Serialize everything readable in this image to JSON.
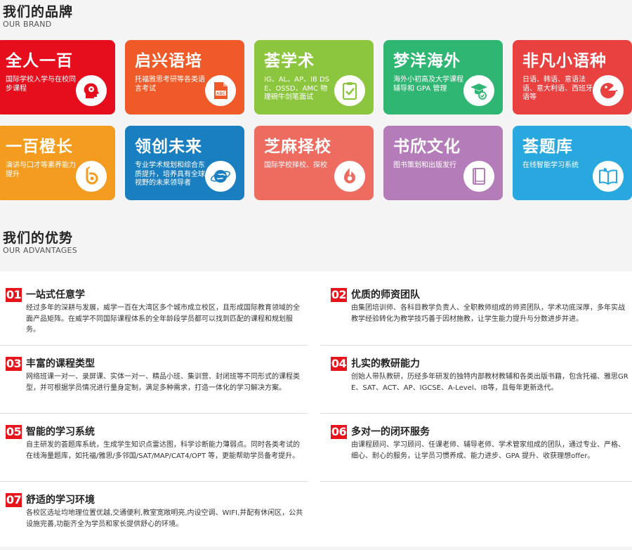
{
  "brand_section": {
    "title": "我们的品牌",
    "subtitle": "OUR BRAND"
  },
  "brands": [
    {
      "name": "全人一百",
      "desc": "国际学校入学与在校同步课程",
      "color": "#e60d1d",
      "icon": "head-gear-icon"
    },
    {
      "name": "启兴语培",
      "desc": "托福雅思考研等各类语言考试",
      "color": "#f05a28",
      "icon": "abc-document-icon"
    },
    {
      "name": "荟学术",
      "desc": "IG、AL、AP、IB DSE、OSSD、AMC 物理碗牛剑笔面试",
      "color": "#8cc63f",
      "icon": "clipboard-check-icon"
    },
    {
      "name": "梦洋海外",
      "desc": "海外小初高及大学课程辅导和 GPA 管理",
      "color": "#2fb673",
      "icon": "graduate-icon"
    },
    {
      "name": "非凡小语种",
      "desc": "日语、韩语、意语法语、意大利语、西班牙语等",
      "color": "#e94040",
      "icon": "speech-face-icon"
    },
    {
      "name": "一百橙长",
      "desc": "演讲与口才等素养能力提升",
      "color": "#f39c1f",
      "icon": "growth-logo-icon"
    },
    {
      "name": "领创未来",
      "desc": "专业学术规划和综合东质提升，培养具有全球视野的未来领导者",
      "color": "#1a7fc1",
      "icon": "globe-icon"
    },
    {
      "name": "芝麻择校",
      "desc": "国际学校择校、探校",
      "color": "#ee6b60",
      "icon": "location-pin-icon"
    },
    {
      "name": "书欣文化",
      "desc": "图书策划和出版发行",
      "color": "#b47cb8",
      "icon": "book-icon"
    },
    {
      "name": "荟题库",
      "desc": "在线智能学习系统",
      "color": "#29a8e0",
      "icon": "open-book-icon"
    }
  ],
  "advantage_section": {
    "title": "我们的优势",
    "subtitle": "OUR ADVANTAGES"
  },
  "advantages": [
    {
      "num": "01",
      "title": "一站式任意学",
      "desc": "经过多年的深耕与发展，威学一百在大湾区多个城市成立校区，且形成国际教育领域的全面产品矩阵。在威学不同国际课程体系的全年龄段学员都可以找到匹配的课程和规划服务。"
    },
    {
      "num": "02",
      "title": "优质的师资团队",
      "desc": "由集团培训师、各科目教学负责人、全职教师组成的师资团队，学术功底深厚，多年实战教学经验转化为教学技巧善于因材施教，让学生能力提升与分数进步并进。"
    },
    {
      "num": "03",
      "title": "丰富的课程类型",
      "desc": "网络班课一对一、录屏课、实体一对一、精品小班、集训营、封闭班等不同形式的课程类型，并可根据学员情况进行量身定制，满足多种需求，打造一体化的学习解决方案。"
    },
    {
      "num": "04",
      "title": "扎实的教研能力",
      "desc": "创始人带队教研，历经多年研发的独特内部教材教辅和各类出版书籍，包含托福、雅思GRE、SAT、ACT、AP、IGCSE、A-Level、IB等，且每年更新迭代。"
    },
    {
      "num": "05",
      "title": "智能的学习系统",
      "desc": "自主研发的荟题库系统，生成学生知识点雷达图，科学诊断能力薄弱点。同时各类考试的在线海量题库，如托福/雅思/多邻国/SAT/MAP/CAT4/OPT 等，更能帮助学员备考提升。"
    },
    {
      "num": "06",
      "title": "多对一的闭环服务",
      "desc": "由课程顾问、学习顾问、任课老师、辅导老师、学术管家组成的团队，通过专业、严格、细心、耐心的服务，让学员习惯养成、能力进步、GPA 提升、收获理想offer。"
    },
    {
      "num": "07",
      "title": "舒适的学习环境",
      "desc": "各校区选址均地理位置优越,交通便利,教室宽敞明亮,内设空调、WIFI,并配有休闲区，公共设施完善,功能齐全为学员和家长提供舒心的环境。"
    }
  ]
}
